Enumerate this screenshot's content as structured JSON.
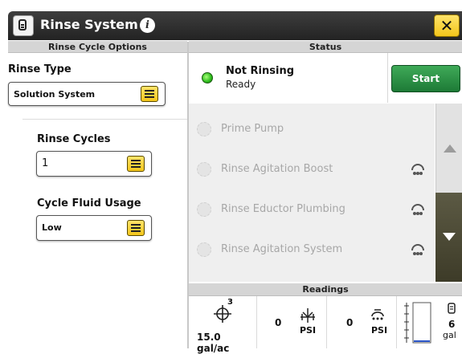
{
  "header": {
    "title": "Rinse System",
    "info_glyph": "i",
    "close_glyph": "✕"
  },
  "left": {
    "section_title": "Rinse Cycle Options",
    "rinse_type": {
      "label": "Rinse Type",
      "value": "Solution System"
    },
    "rinse_cycles": {
      "label": "Rinse Cycles",
      "value": "1"
    },
    "cycle_fluid_usage": {
      "label": "Cycle Fluid Usage",
      "value": "Low"
    }
  },
  "status": {
    "section_title": "Status",
    "main": "Not Rinsing",
    "sub": "Ready",
    "start_label": "Start",
    "led_color": "#2cbb1c",
    "steps": [
      {
        "label": "Prime Pump",
        "icon": "none"
      },
      {
        "label": "Rinse Agitation Boost",
        "icon": "nozzle-icon"
      },
      {
        "label": "Rinse Eductor Plumbing",
        "icon": "nozzle-icon"
      },
      {
        "label": "Rinse Agitation System",
        "icon": "nozzle-icon"
      }
    ]
  },
  "readings": {
    "section_title": "Readings",
    "rate": {
      "value": "15.0 gal/ac",
      "superscript": "3",
      "icon": "target-icon"
    },
    "pressure1": {
      "value": "0",
      "unit": "PSI",
      "icon": "valve-pressure-icon"
    },
    "pressure2": {
      "value": "0",
      "unit": "PSI",
      "icon": "nozzle-pressure-icon"
    },
    "tank": {
      "value": "6",
      "unit": "gal",
      "icon": "tank-icon"
    }
  },
  "colors": {
    "accent_yellow": "#f2c51b",
    "start_green": "#2a9447",
    "header_dark": "#2b2b2b"
  }
}
